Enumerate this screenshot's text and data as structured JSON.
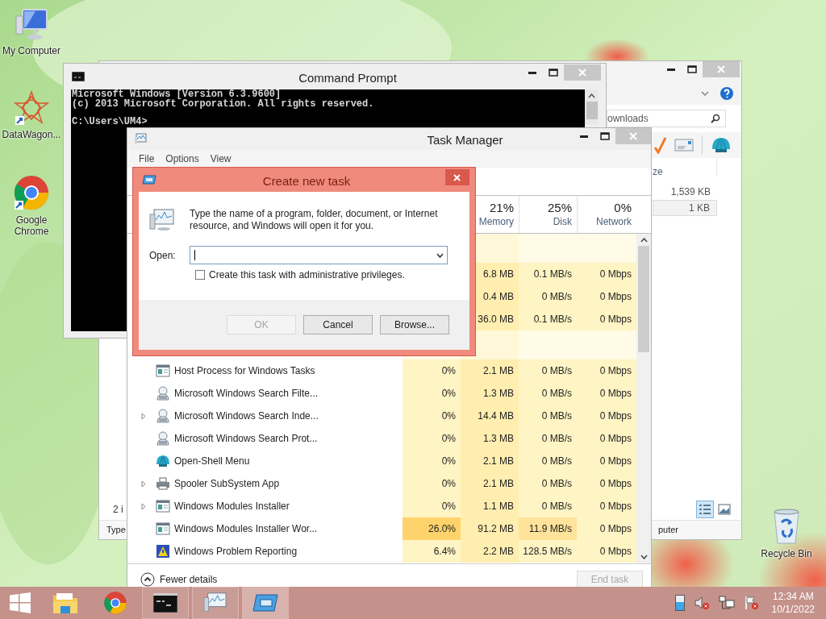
{
  "desktop_icons": [
    {
      "kind": "computer",
      "label": "My Computer"
    },
    {
      "kind": "star",
      "label": "DataWagon..."
    },
    {
      "kind": "chrome",
      "label": "Google Chrome"
    },
    {
      "kind": "recycle",
      "label": "Recycle Bin"
    }
  ],
  "explorer": {
    "search": "ownloads",
    "size_header": "ze",
    "sizes": [
      {
        "text": "1,539 KB",
        "selected": false
      },
      {
        "text": "1 KB",
        "selected": true
      }
    ],
    "status": "2 i",
    "views": [
      {
        "kind": "details",
        "selected": true
      },
      {
        "kind": "preview",
        "selected": false
      }
    ],
    "details_label": "Type",
    "details_value": "puter"
  },
  "command_prompt": {
    "title": "Command Prompt",
    "output": [
      "Microsoft Windows [Version 6.3.9600]",
      "(c) 2013 Microsoft Corporation. All rights reserved."
    ],
    "prompt": "C:\\Users\\UM4>"
  },
  "task_manager": {
    "title": "Task Manager",
    "menu": [
      "File",
      "Options",
      "View"
    ],
    "columns": [
      {
        "percent": "21%",
        "label": "Memory"
      },
      {
        "percent": "25%",
        "label": "Disk"
      },
      {
        "percent": "0%",
        "label": "Network"
      }
    ],
    "top_rows": [
      {
        "memory": "6.8 MB",
        "disk": "0.1 MB/s",
        "network": "0 Mbps"
      },
      {
        "memory": "0.4 MB",
        "disk": "0 MB/s",
        "network": "0 Mbps"
      },
      {
        "memory": "36.0 MB",
        "disk": "0.1 MB/s",
        "network": "0 Mbps"
      }
    ],
    "rows": [
      {
        "kind": "window",
        "name": "Host Process for Windows Tasks",
        "expandable": false,
        "cpu": "0%",
        "memory": "2.1 MB",
        "disk": "0 MB/s",
        "network": "0 Mbps",
        "hot": false
      },
      {
        "kind": "search",
        "name": "Microsoft Windows Search Filte...",
        "expandable": false,
        "cpu": "0%",
        "memory": "1.3 MB",
        "disk": "0 MB/s",
        "network": "0 Mbps",
        "hot": false
      },
      {
        "kind": "search",
        "name": "Microsoft Windows Search Inde...",
        "expandable": true,
        "cpu": "0%",
        "memory": "14.4 MB",
        "disk": "0 MB/s",
        "network": "0 Mbps",
        "hot": false
      },
      {
        "kind": "search",
        "name": "Microsoft Windows Search Prot...",
        "expandable": false,
        "cpu": "0%",
        "memory": "1.3 MB",
        "disk": "0 MB/s",
        "network": "0 Mbps",
        "hot": false
      },
      {
        "kind": "shell",
        "name": "Open-Shell Menu",
        "expandable": false,
        "cpu": "0%",
        "memory": "2.1 MB",
        "disk": "0 MB/s",
        "network": "0 Mbps",
        "hot": false
      },
      {
        "kind": "printer",
        "name": "Spooler SubSystem App",
        "expandable": true,
        "cpu": "0%",
        "memory": "2.1 MB",
        "disk": "0 MB/s",
        "network": "0 Mbps",
        "hot": false
      },
      {
        "kind": "window",
        "name": "Windows Modules Installer",
        "expandable": true,
        "cpu": "0%",
        "memory": "1.1 MB",
        "disk": "0 MB/s",
        "network": "0 Mbps",
        "hot": false
      },
      {
        "kind": "window",
        "name": "Windows Modules Installer Wor...",
        "expandable": false,
        "cpu": "26.0%",
        "memory": "91.2 MB",
        "disk": "11.9 MB/s",
        "network": "0 Mbps",
        "hot": true
      },
      {
        "kind": "report",
        "name": "Windows Problem Reporting",
        "expandable": false,
        "cpu": "6.4%",
        "memory": "2.2 MB",
        "disk": "128.5 MB/s",
        "network": "0 Mbps",
        "hot": false
      }
    ],
    "details_toggle": "Fewer details",
    "end_task": {
      "label": "End task",
      "disabled": true
    }
  },
  "dialog": {
    "title": "Create new task",
    "message": "Type the name of a program, folder, document, or Internet resource, and Windows will open it for you.",
    "open_label": "Open:",
    "admin": {
      "label": "Create this task with administrative privileges.",
      "checked": false
    },
    "buttons": [
      {
        "label": "OK",
        "disabled": true
      },
      {
        "label": "Cancel",
        "disabled": false
      },
      {
        "label": "Browse...",
        "disabled": false
      }
    ]
  },
  "taskbar": {
    "items": [
      {
        "kind": "explorer",
        "running": false,
        "selected": false
      },
      {
        "kind": "chrome",
        "running": false,
        "selected": false
      },
      {
        "kind": "cmd",
        "running": true,
        "selected": false
      },
      {
        "kind": "taskmgr",
        "running": true,
        "selected": false
      },
      {
        "kind": "dialog",
        "running": true,
        "selected": true
      }
    ],
    "time": "12:34 AM",
    "date": "10/1/2022"
  }
}
